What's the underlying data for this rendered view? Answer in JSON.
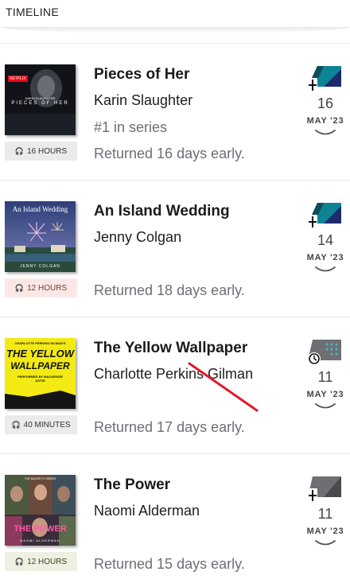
{
  "header": {
    "title": "TIMELINE"
  },
  "items": [
    {
      "title": "Pieces of Her",
      "author": "Karin Slaughter",
      "series": "#1 in series",
      "returned": "Returned 16 days early.",
      "duration": "16 HOURS",
      "day": "16",
      "month": "MAY '23",
      "format_icon": "audiobook-add-icon",
      "cover": {
        "badge": "NETFLIX",
        "author": "KARIN SLAUGHTER",
        "title": "PIECES OF HER",
        "bg": "#111318"
      },
      "duration_bg": "#ebebee",
      "duration_fg": "#333333"
    },
    {
      "title": "An Island Wedding",
      "author": "Jenny Colgan",
      "series": "",
      "returned": "Returned 18 days early.",
      "duration": "12 HOURS",
      "day": "14",
      "month": "MAY '23",
      "format_icon": "audiobook-add-icon",
      "cover": {
        "title": "An Island Wedding",
        "author": "JENNY COLGAN",
        "bg": "#4a5a86"
      },
      "duration_bg": "#fbe8e6",
      "duration_fg": "#7a3a34"
    },
    {
      "title": "The Yellow Wallpaper",
      "author": "Charlotte Perkins Gilman",
      "series": "",
      "returned": "Returned 17 days early.",
      "duration": "40 MINUTES",
      "day": "11",
      "month": "MAY '23",
      "format_icon": "audiobook-expiring-icon",
      "cover": {
        "author": "CHARLOTTE PERKINS GILMAN'S",
        "title1": "THE YELLOW",
        "title2": "WALLPAPER",
        "narrator": "PERFORMED BY MACKENZIE ASTIN",
        "bg": "#f3ea13"
      },
      "duration_bg": "#ebebee",
      "duration_fg": "#333333"
    },
    {
      "title": "The Power",
      "author": "Naomi Alderman",
      "series": "",
      "returned": "Returned 15 days early.",
      "duration": "12 HOURS",
      "day": "11",
      "month": "MAY '23",
      "format_icon": "audiobook-add-icon",
      "cover": {
        "badge": "THE MAJOR TV SERIES",
        "title": "THE POWER",
        "author": "NAOMI ALDERMAN",
        "bg": "#27302a"
      },
      "duration_bg": "#eef0e2",
      "duration_fg": "#3d4222"
    }
  ],
  "colors": {
    "teal_dark": "#0e4d57",
    "teal_light": "#0d8494",
    "navy": "#1d2a6b",
    "gray_tile": "#6f6f73",
    "annotation_red": "#e0192b"
  }
}
